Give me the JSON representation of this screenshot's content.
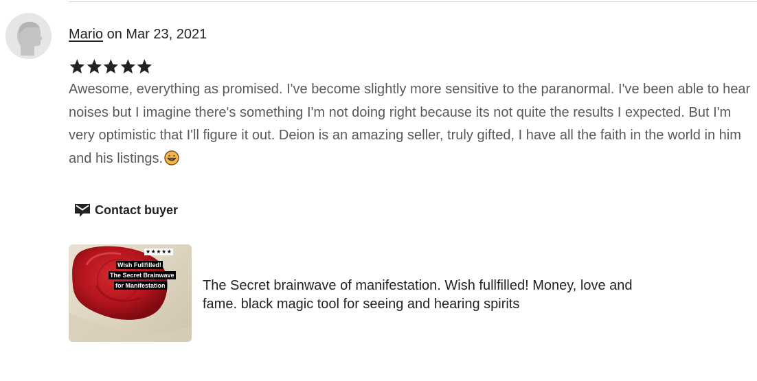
{
  "review": {
    "reviewer_name": "Mario",
    "date_text": " on Mar 23, 2021",
    "rating": 5,
    "rating_max": 5,
    "text": "Awesome, everything as promised. I've become slightly more sensitive to the paranormal. I've been able to hear noises but I imagine there's something I'm not doing right because its not quite the results I expected. But I'm very optimistic that I'll figure it out. Deion is an amazing seller, truly gifted, I have all the faith in the world in him and his listings.",
    "emoji": "grinning-face-emoji"
  },
  "actions": {
    "contact_buyer_label": "Contact buyer",
    "contact_icon": "envelope-icon"
  },
  "listing": {
    "title": "The Secret brainwave of manifestation. Wish fullfilled! Money, love and fame. black magic tool for seeing and hearing spirits",
    "thumbnail": {
      "badge": "★★★★★",
      "caption_lines": [
        "Wish Fullfilled!",
        "The Secret Brainwave",
        "for Manifestation"
      ]
    }
  },
  "colors": {
    "text_primary": "#222222",
    "text_review": "#595959",
    "divider": "#d6d6d6",
    "wax_seal": "#b5151d"
  }
}
